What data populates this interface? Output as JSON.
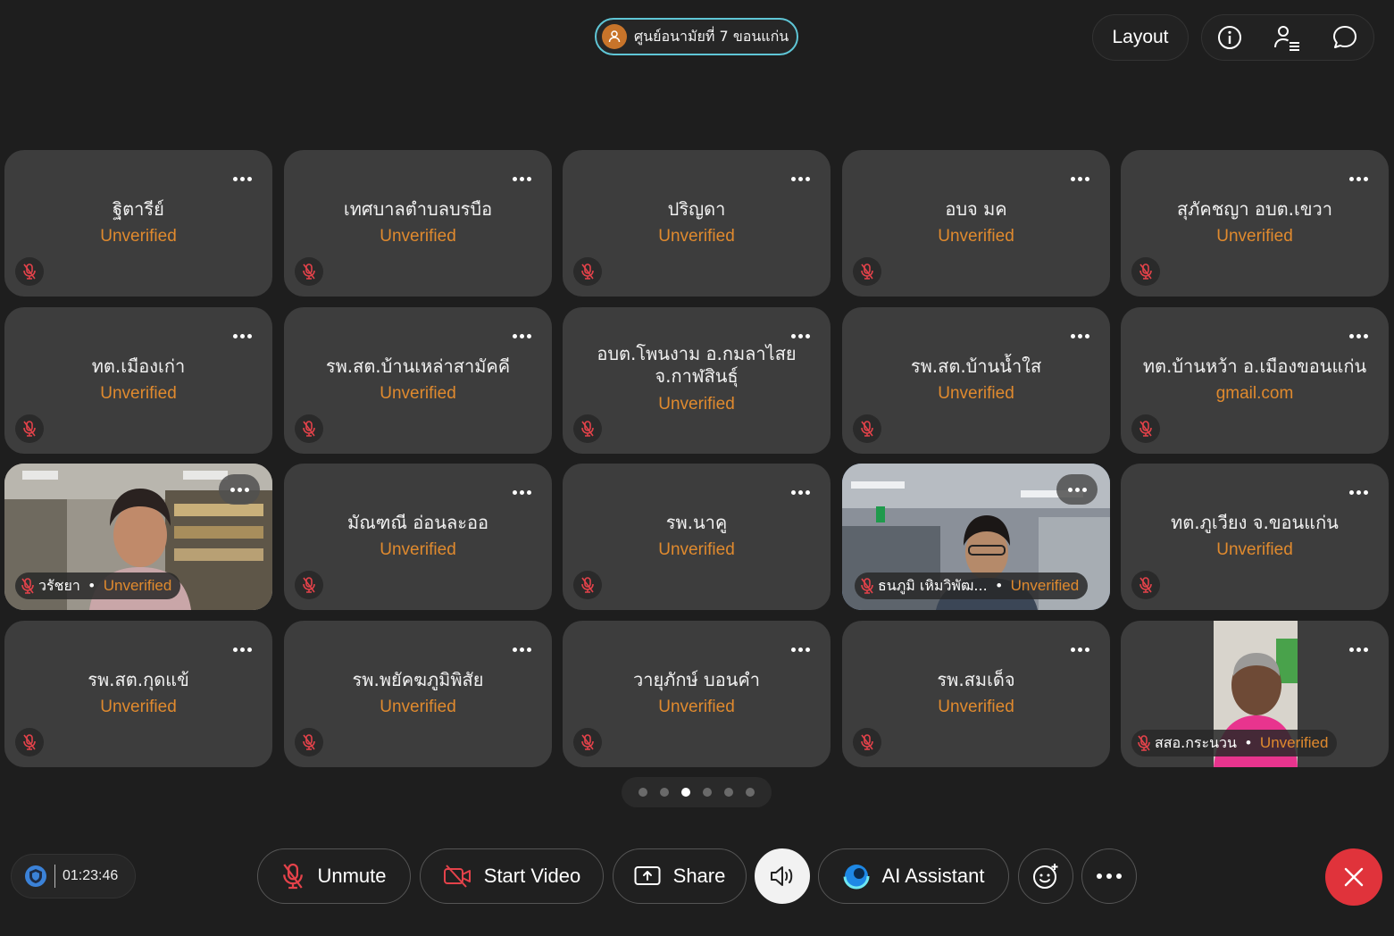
{
  "header": {
    "host_name": "ศูนย์อนามัยที่ 7 ขอนแก่น",
    "layout_label": "Layout"
  },
  "tiles": [
    {
      "name": "ฐิตารีย์",
      "sub": "Unverified"
    },
    {
      "name": "เทศบาลตำบลบรบือ",
      "sub": "Unverified"
    },
    {
      "name": "ปริญดา",
      "sub": "Unverified"
    },
    {
      "name": "อบจ มค",
      "sub": "Unverified"
    },
    {
      "name": "สุภัคชญา อบต.เขวา",
      "sub": "Unverified"
    },
    {
      "name": "ทต.เมืองเก่า",
      "sub": "Unverified"
    },
    {
      "name": "รพ.สต.บ้านเหล่าสามัคคี",
      "sub": "Unverified"
    },
    {
      "name_line1": "อบต.โพนงาม อ.กมลาไสย",
      "name_line2": "จ.กาฬสินธุ์",
      "sub": "Unverified"
    },
    {
      "name": "รพ.สต.บ้านน้ำใส",
      "sub": "Unverified"
    },
    {
      "name": "ทต.บ้านหว้า อ.เมืองขอนแก่น",
      "sub": "gmail.com"
    },
    {
      "name": "วรัชยา",
      "sub": "Unverified"
    },
    {
      "name": "มัณฑณี อ่อนละออ",
      "sub": "Unverified"
    },
    {
      "name": "รพ.นาคู",
      "sub": "Unverified"
    },
    {
      "name": "ธนภูมิ เหิมวิพัฒ...",
      "sub": "Unverified"
    },
    {
      "name": "ทต.ภูเวียง จ.ขอนแก่น",
      "sub": "Unverified"
    },
    {
      "name": "รพ.สต.กุดแข้",
      "sub": "Unverified"
    },
    {
      "name": "รพ.พยัคฆภูมิพิสัย",
      "sub": "Unverified"
    },
    {
      "name": "วายุภักษ์ บอนคำ",
      "sub": "Unverified"
    },
    {
      "name": "รพ.สมเด็จ",
      "sub": "Unverified"
    },
    {
      "name": "สสอ.กระนวน",
      "sub": "Unverified"
    }
  ],
  "pager": {
    "pages": 6,
    "current": 3
  },
  "bottom": {
    "timer": "01:23:46",
    "unmute": "Unmute",
    "start_video": "Start Video",
    "share": "Share",
    "ai_assistant": "AI Assistant"
  },
  "colors": {
    "accent_unverified": "#e08a2e",
    "leave": "#e0333b",
    "host_ring": "#5fc6d6"
  }
}
